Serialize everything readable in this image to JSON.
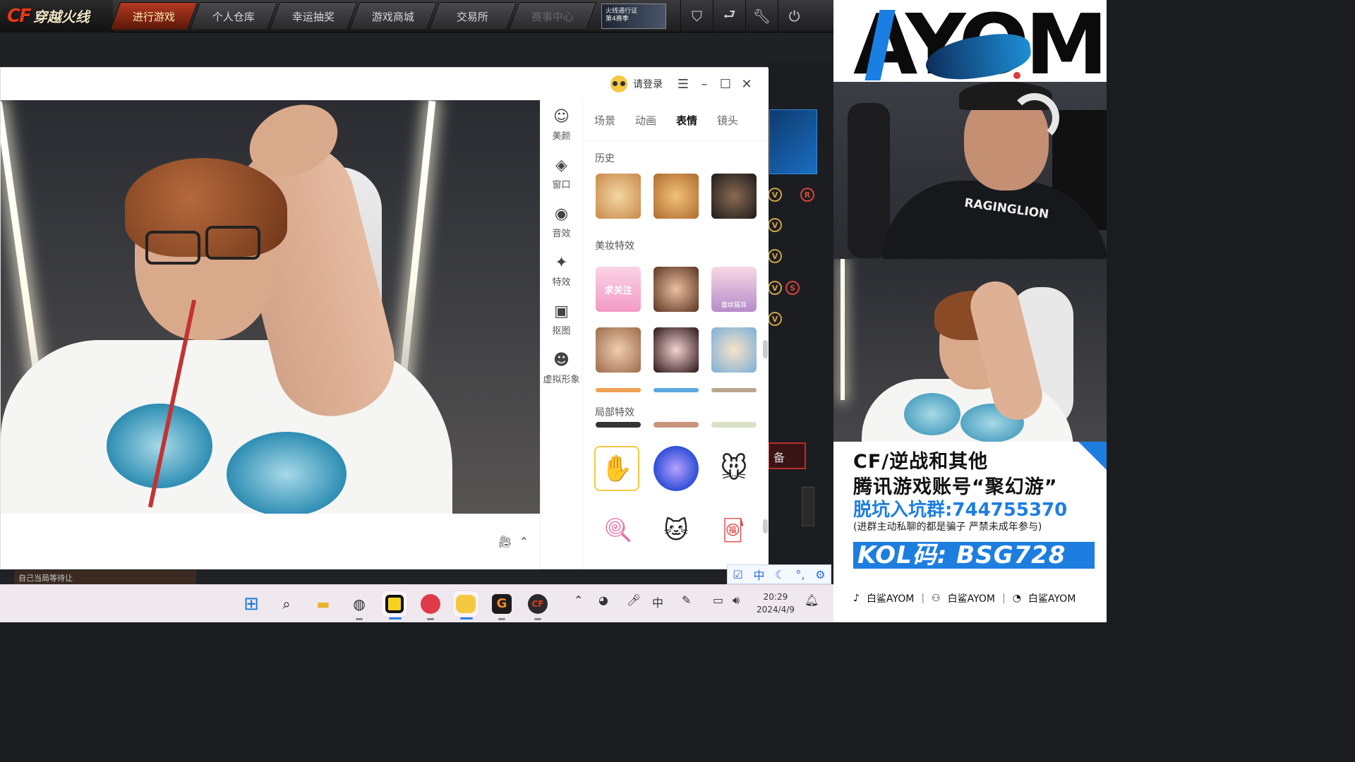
{
  "game": {
    "logo_mark": "CF",
    "logo_name": "穿越火线",
    "tabs": [
      {
        "label": "进行游戏",
        "active": true
      },
      {
        "label": "个人仓库"
      },
      {
        "label": "幸运抽奖"
      },
      {
        "label": "游戏商城"
      },
      {
        "label": "交易所"
      },
      {
        "label": "赛事中心",
        "dim": true
      }
    ],
    "banner_line1": "火线通行证",
    "banner_line2": "第4赛季",
    "right_badges": [
      "V",
      "R",
      "V",
      "V",
      "V",
      "S",
      "V"
    ],
    "red_button_char": "备",
    "bottom_strip_text": "自己当局等待让"
  },
  "camera_app": {
    "login_label": "请登录",
    "side_items": [
      {
        "label": "美颜",
        "icon": "beauty-face-icon"
      },
      {
        "label": "窗口",
        "icon": "layers-icon"
      },
      {
        "label": "音效",
        "icon": "audio-icon"
      },
      {
        "label": "特效",
        "icon": "magic-wand-icon"
      },
      {
        "label": "抠图",
        "icon": "cutout-icon"
      },
      {
        "label": "虚拟形象",
        "icon": "avatar-icon"
      }
    ],
    "panel_tabs": [
      {
        "label": "场景"
      },
      {
        "label": "动画"
      },
      {
        "label": "表情",
        "active": true
      },
      {
        "label": "镜头"
      }
    ],
    "section_history": "历史",
    "section_makeup": "美妆特效",
    "section_local": "局部特效",
    "makeup_thumb_texts": [
      "求关注",
      "",
      "蕾丝猫耳"
    ]
  },
  "ime": {
    "lang": "中"
  },
  "taskbar": {
    "time": "20:29",
    "date": "2024/4/9",
    "tray_lang": "中"
  },
  "overlay": {
    "brand": "AYOM",
    "camera2_shirt_text": "RAGINGLION",
    "line1": "CF/逆战和其他",
    "line2": "腾讯游戏账号“聚幻游”",
    "line3": "脱坑入坑群:744755370",
    "line4": "(进群主动私聊的都是骗子 严禁未成年参与)",
    "kol": "KOL码: BSG728",
    "social": [
      {
        "platform": "douyin",
        "label": "白鲨AYOM"
      },
      {
        "platform": "kuaishou",
        "label": "白鲨AYOM"
      },
      {
        "platform": "weibo",
        "label": "白鲨AYOM"
      }
    ],
    "colors": {
      "accent": "#1d7ee0"
    }
  }
}
